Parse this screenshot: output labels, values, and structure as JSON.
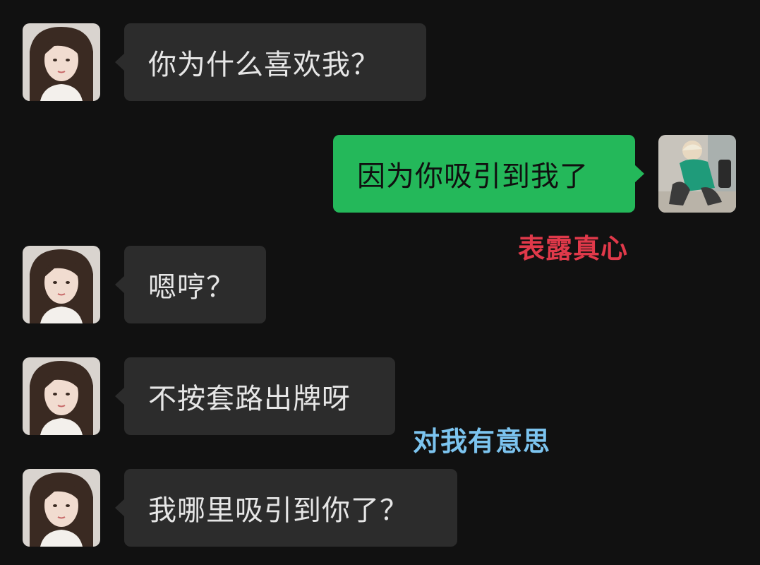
{
  "messages": [
    {
      "side": "incoming",
      "text": "你为什么喜欢我？"
    },
    {
      "side": "outgoing",
      "text": "因为你吸引到我了"
    },
    {
      "side": "incoming",
      "text": "嗯哼？"
    },
    {
      "side": "incoming",
      "text": "不按套路出牌呀"
    },
    {
      "side": "incoming",
      "text": "我哪里吸引到你了？"
    }
  ],
  "annotations": [
    {
      "text": "表露真心",
      "color": "#e0394a"
    },
    {
      "text": "对我有意思",
      "color": "#7cc4ef"
    }
  ],
  "avatars": {
    "contact": "girl-portrait-avatar",
    "self": "man-squatting-avatar"
  },
  "colors": {
    "background": "#111111",
    "incoming_bubble": "#2c2c2c",
    "outgoing_bubble": "#24b85a"
  }
}
